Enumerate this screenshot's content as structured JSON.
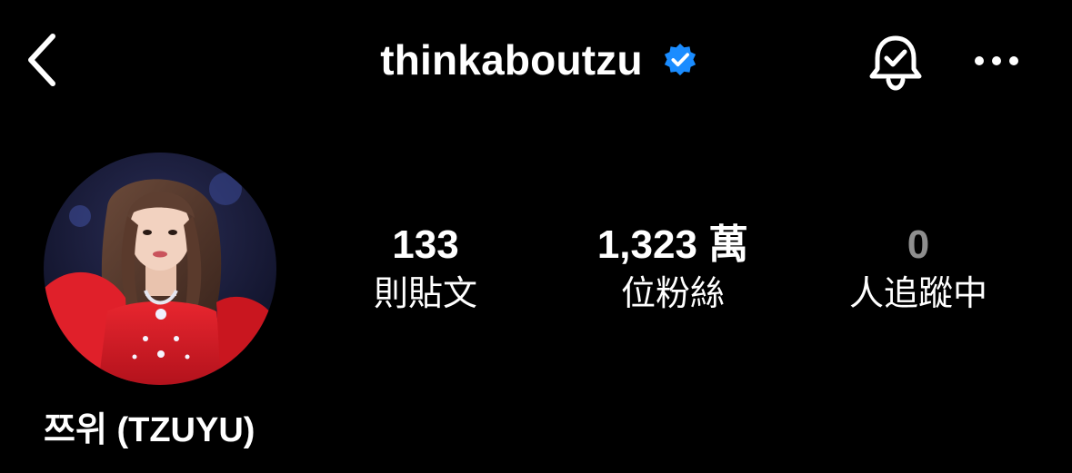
{
  "header": {
    "username": "thinkaboutzu",
    "verified": true,
    "icons": {
      "back": "chevron-left-icon",
      "verified": "verified-badge-icon",
      "notifications": "bell-check-icon",
      "more": "more-horizontal-icon"
    },
    "colors": {
      "verified_badge": "#1a8cff"
    }
  },
  "profile": {
    "display_name": "쯔위 (TZUYU)",
    "avatar": "profile-photo"
  },
  "stats": {
    "posts": {
      "value": "133",
      "label": "則貼文"
    },
    "followers": {
      "value": "1,323 萬",
      "label": "位粉絲"
    },
    "following": {
      "value": "0",
      "label": "人追蹤中"
    }
  }
}
